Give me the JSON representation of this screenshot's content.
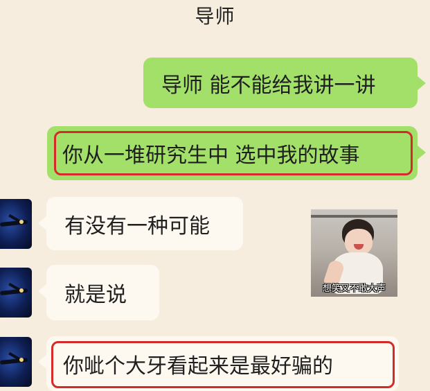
{
  "header": {
    "title": "导师"
  },
  "messages": [
    {
      "side": "right",
      "text": "导师 能不能给我讲一讲",
      "highlighted": false
    },
    {
      "side": "right",
      "text": "你从一堆研究生中 选中我的故事",
      "highlighted": true
    },
    {
      "side": "left",
      "text": "有没有一种可能",
      "highlighted": false
    },
    {
      "side": "left",
      "text": "就是说",
      "highlighted": false
    },
    {
      "side": "left",
      "text": "你呲个大牙看起来是最好骗的",
      "highlighted": true
    }
  ],
  "sticker": {
    "caption": "想笑又不敢大声"
  },
  "colors": {
    "background": "#f6edde",
    "sent_bubble": "#a3e06a",
    "received_bubble": "#fdf9f1",
    "highlight_outline": "#d42a2a"
  }
}
